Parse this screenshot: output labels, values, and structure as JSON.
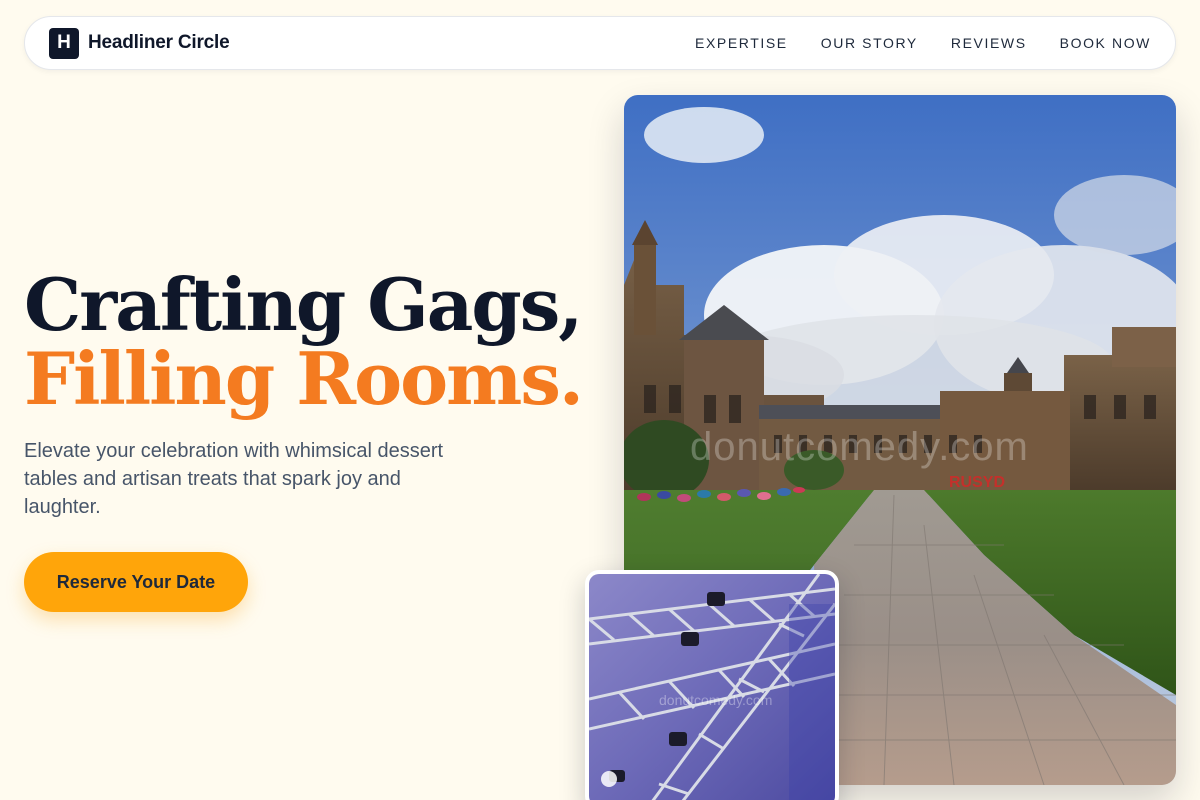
{
  "header": {
    "logo_letter": "H",
    "brand_name": "Headliner Circle",
    "nav": [
      {
        "label": "EXPERTISE"
      },
      {
        "label": "OUR STORY"
      },
      {
        "label": "REVIEWS"
      },
      {
        "label": "BOOK NOW"
      }
    ]
  },
  "hero": {
    "title_line1": "Crafting Gags,",
    "title_line2": "Filling Rooms.",
    "subtitle": "Elevate your celebration with whimsical dessert tables and artisan treats that spark joy and laughter.",
    "cta_label": "Reserve Your Date"
  },
  "images": {
    "main_watermark": "donutcomedy.com",
    "small_watermark": "donutcomedy.com"
  },
  "colors": {
    "background": "#fffbef",
    "headline_dark": "#0f172a",
    "headline_accent": "#f47b20",
    "cta": "#ffa50a"
  }
}
